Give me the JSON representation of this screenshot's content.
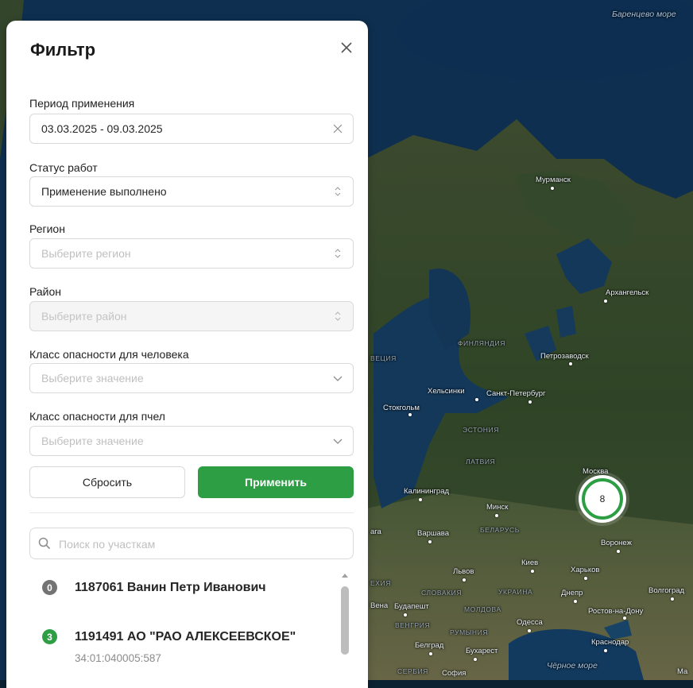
{
  "map": {
    "seas": [
      "Баренцево море",
      "Чёрное море"
    ],
    "countries": [
      "ФИНЛЯНДИЯ",
      "ЭСТОНИЯ",
      "ЛАТВИЯ",
      "БЕЛАРУСЬ",
      "СЛОВАКИЯ",
      "УКРАИНА",
      "МОЛДОВА",
      "РУМЫНИЯ",
      "ВЕНГРИЯ",
      "СЕРБИЯ",
      "ВЕЦИЯ",
      "ЕХИЯ"
    ],
    "cities": [
      "Мурманск",
      "Архангельск",
      "Петрозаводск",
      "Хельсинки",
      "Санкт-Петербург",
      "Стокгольм",
      "Москва",
      "Калининград",
      "Минск",
      "Варшава",
      "Воронеж",
      "Киев",
      "Львов",
      "Харьков",
      "Днепр",
      "Волгоград",
      "Будапешт",
      "Одесса",
      "Ростов-на-Дону",
      "Белград",
      "Бухарест",
      "Краснодар",
      "София",
      "Вена",
      "Ма",
      "ага"
    ],
    "cluster_count": "8",
    "cluster_color": "#2e9e45"
  },
  "filter": {
    "title": "Фильтр",
    "fields": [
      {
        "label": "Период применения",
        "value": "03.03.2025 - 09.03.2025",
        "placeholder": "",
        "icon": "clear-icon",
        "disabled": false
      },
      {
        "label": "Статус работ",
        "value": "Применение выполнено",
        "placeholder": "",
        "icon": "sort-icon",
        "disabled": false
      },
      {
        "label": "Регион",
        "value": "",
        "placeholder": "Выберите регион",
        "icon": "sort-icon",
        "disabled": false
      },
      {
        "label": "Район",
        "value": "",
        "placeholder": "Выберите район",
        "icon": "sort-icon",
        "disabled": true
      },
      {
        "label": "Класс опасности для человека",
        "value": "",
        "placeholder": "Выберите значение",
        "icon": "chevron-down-icon",
        "disabled": false
      },
      {
        "label": "Класс опасности для пчел",
        "value": "",
        "placeholder": "Выберите значение",
        "icon": "chevron-down-icon",
        "disabled": false
      }
    ],
    "reset_label": "Сбросить",
    "apply_label": "Применить",
    "accent_color": "#2e9e45",
    "search_placeholder": "Поиск по участкам",
    "items": [
      {
        "badge": "0",
        "badge_color": "#737373",
        "title": "1187061 Ванин Петр Иванович",
        "subtitle": ""
      },
      {
        "badge": "3",
        "badge_color": "#2e9e45",
        "title": "1191491 АО \"РАО АЛЕКСЕЕВСКОЕ\"",
        "subtitle": "34:01:040005:587"
      }
    ]
  }
}
